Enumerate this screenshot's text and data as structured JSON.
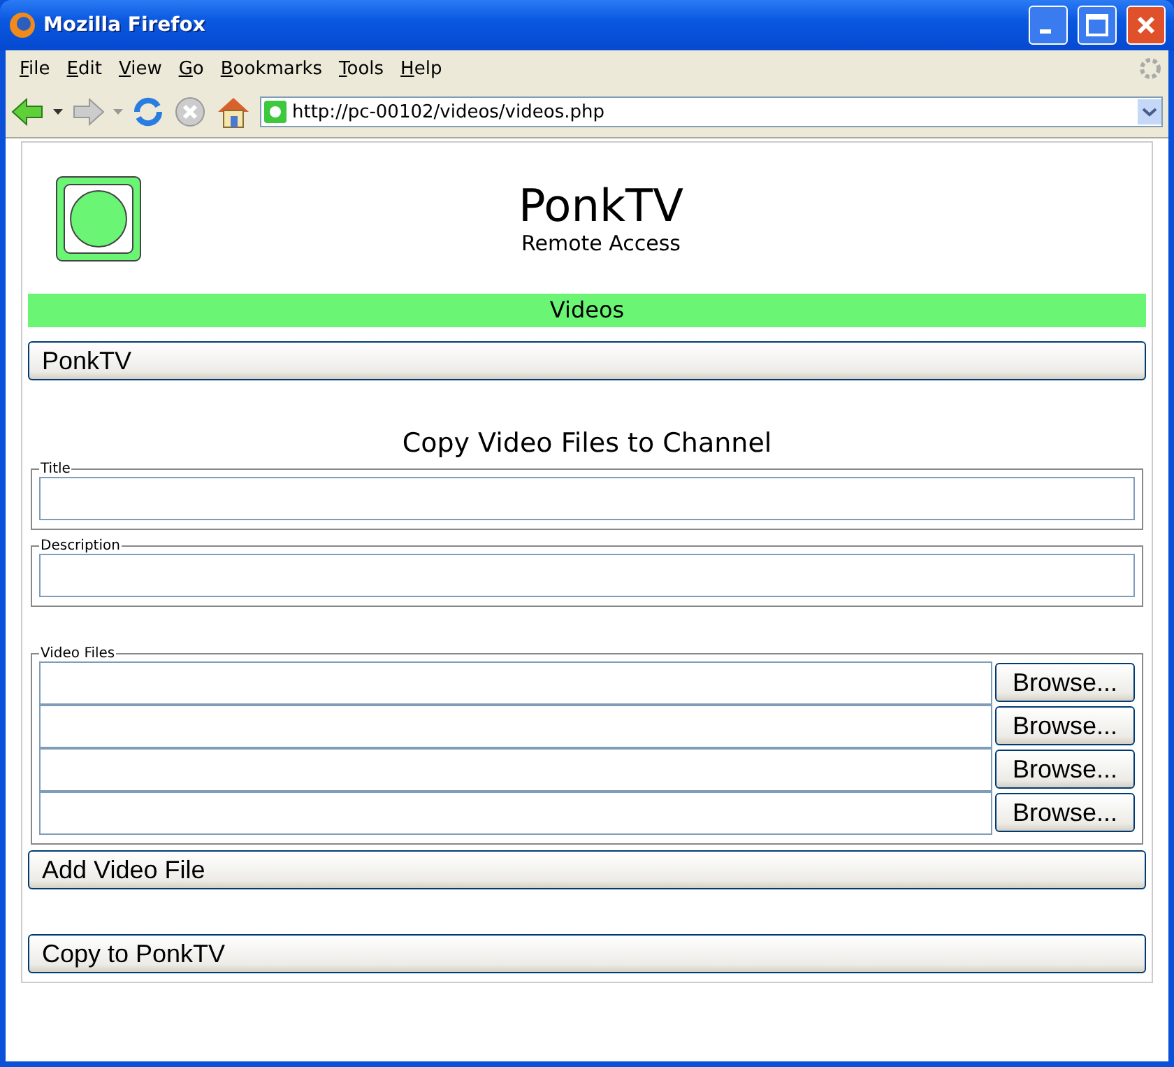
{
  "window": {
    "title": "Mozilla Firefox"
  },
  "menu": [
    "File",
    "Edit",
    "View",
    "Go",
    "Bookmarks",
    "Tools",
    "Help"
  ],
  "address": {
    "value": "http://pc-00102/videos/videos.php"
  },
  "page": {
    "title": "PonkTV",
    "subtitle": "Remote Access",
    "section": "Videos",
    "channel_button": "PonkTV",
    "heading": "Copy Video Files to Channel",
    "fields": [
      {
        "legend": "Title"
      },
      {
        "legend": "Description"
      }
    ],
    "files": {
      "legend": "Video Files",
      "rows": [
        {
          "browse": "Browse..."
        },
        {
          "browse": "Browse..."
        },
        {
          "browse": "Browse..."
        },
        {
          "browse": "Browse..."
        }
      ]
    },
    "add_button": "Add Video File",
    "copy_button": "Copy to PonkTV"
  }
}
